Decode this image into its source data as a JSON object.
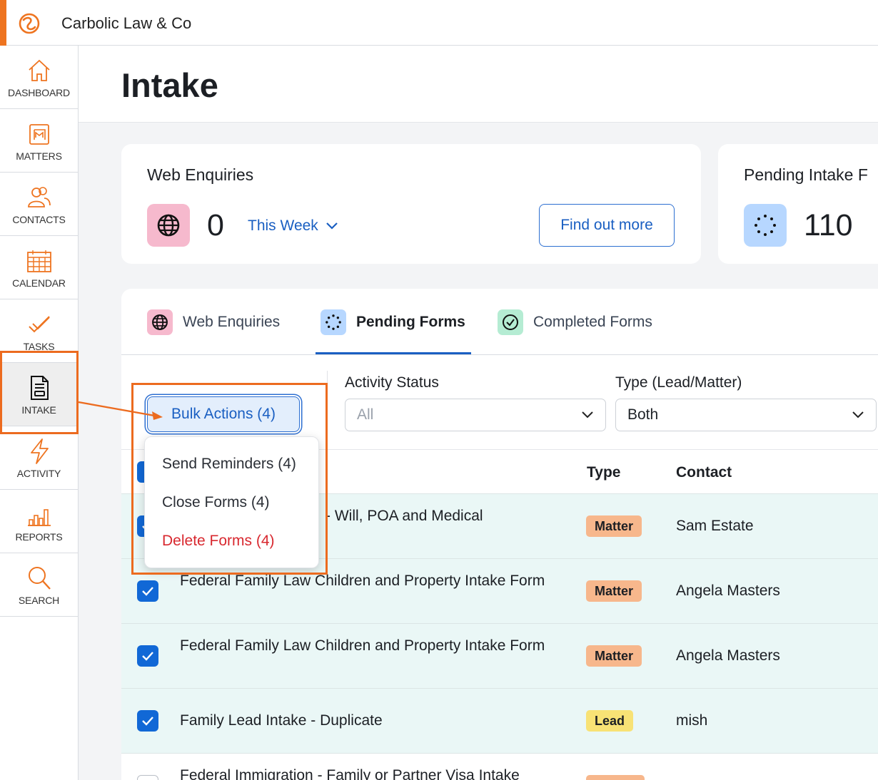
{
  "app": {
    "firm_name": "Carbolic Law & Co"
  },
  "colors": {
    "accent": "#ee7420",
    "primary": "#1a5fc2",
    "danger": "#d8282f",
    "row_bg": "#eaf7f6",
    "highlight": "#ec6b1f"
  },
  "sidebar": {
    "items": [
      {
        "label": "DASHBOARD",
        "icon": "home-icon"
      },
      {
        "label": "MATTERS",
        "icon": "matters-icon"
      },
      {
        "label": "CONTACTS",
        "icon": "contacts-icon"
      },
      {
        "label": "CALENDAR",
        "icon": "calendar-icon"
      },
      {
        "label": "TASKS",
        "icon": "tasks-icon"
      },
      {
        "label": "INTAKE",
        "icon": "intake-icon",
        "active": true
      },
      {
        "label": "ACTIVITY",
        "icon": "lightning-icon"
      },
      {
        "label": "REPORTS",
        "icon": "bar-chart-icon"
      },
      {
        "label": "SEARCH",
        "icon": "search-icon"
      }
    ]
  },
  "page": {
    "title": "Intake"
  },
  "cards": {
    "web_enquiries": {
      "title": "Web Enquiries",
      "count": "0",
      "period": "This Week",
      "button": "Find out more"
    },
    "pending_intake": {
      "title": "Pending Intake F",
      "count": "110"
    }
  },
  "tabs": [
    {
      "label": "Web Enquiries",
      "icon": "globe-icon"
    },
    {
      "label": "Pending Forms",
      "icon": "spinner-icon",
      "active": true
    },
    {
      "label": "Completed Forms",
      "icon": "check-circle-icon"
    }
  ],
  "filters": {
    "bulk_button": "Bulk Actions (4)",
    "activity_status": {
      "label": "Activity Status",
      "value": "All"
    },
    "type": {
      "label": "Type (Lead/Matter)",
      "value": "Both"
    }
  },
  "bulk_menu": {
    "send": "Send Reminders (4)",
    "close": "Close Forms (4)",
    "delete": "Delete Forms (4)"
  },
  "table": {
    "headers": {
      "type": "Type",
      "contact": "Contact"
    },
    "rows": [
      {
        "name": "- Will, POA and Medical",
        "type": "Matter",
        "contact": "Sam Estate",
        "checked": true
      },
      {
        "name": "Federal Family Law Children and Property Intake Form",
        "type": "Matter",
        "contact": "Angela Masters",
        "checked": true
      },
      {
        "name": "Federal Family Law Children and Property Intake Form",
        "type": "Matter",
        "contact": "Angela Masters",
        "checked": true
      },
      {
        "name": "Family Lead Intake - Duplicate",
        "type": "Lead",
        "contact": "mish",
        "checked": true
      },
      {
        "name": "Federal Immigration - Family or Partner Visa Intake",
        "type": "",
        "contact": "",
        "checked": false
      }
    ]
  }
}
